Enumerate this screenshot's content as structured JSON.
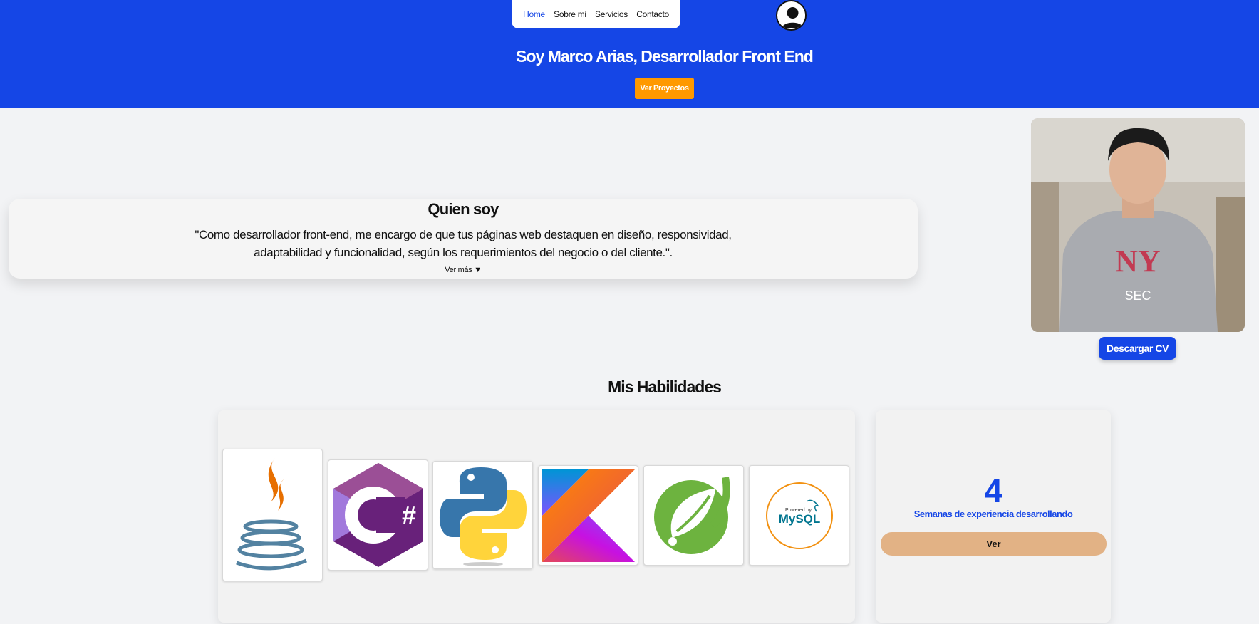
{
  "nav": {
    "items": [
      {
        "label": "Home",
        "active": true
      },
      {
        "label": "Sobre mi",
        "active": false
      },
      {
        "label": "Servicios",
        "active": false
      },
      {
        "label": "Contacto",
        "active": false
      }
    ],
    "avatar_icon": "user-circle-icon"
  },
  "hero": {
    "title": "Soy Marco Arias, Desarrollador Front End",
    "button_label": "Ver Proyectos"
  },
  "about": {
    "heading": "Quien soy",
    "text": "\"Como desarrollador front-end, me encargo de que tus páginas web destaquen en diseño, responsividad, adaptabilidad y funcionalidad, según los requerimientos del negocio o del cliente.\".",
    "more_label": "Ver más ▼"
  },
  "profile": {
    "cv_button_label": "Descargar CV"
  },
  "skills": {
    "heading": "Mis Habilidades",
    "logos": [
      "java-logo",
      "csharp-logo",
      "python-logo",
      "kotlin-logo",
      "spring-logo",
      "mysql-logo"
    ],
    "mysql_caption": "Powered by",
    "mysql_text": "MySQL"
  },
  "experience": {
    "number": "4",
    "label": "Semanas de experiencia desarrollando",
    "button_label": "Ver"
  },
  "colors": {
    "primary": "#1546e6",
    "accent_orange": "#ff9900",
    "ver_button": "#e2b285",
    "background": "#f2f3f5"
  }
}
